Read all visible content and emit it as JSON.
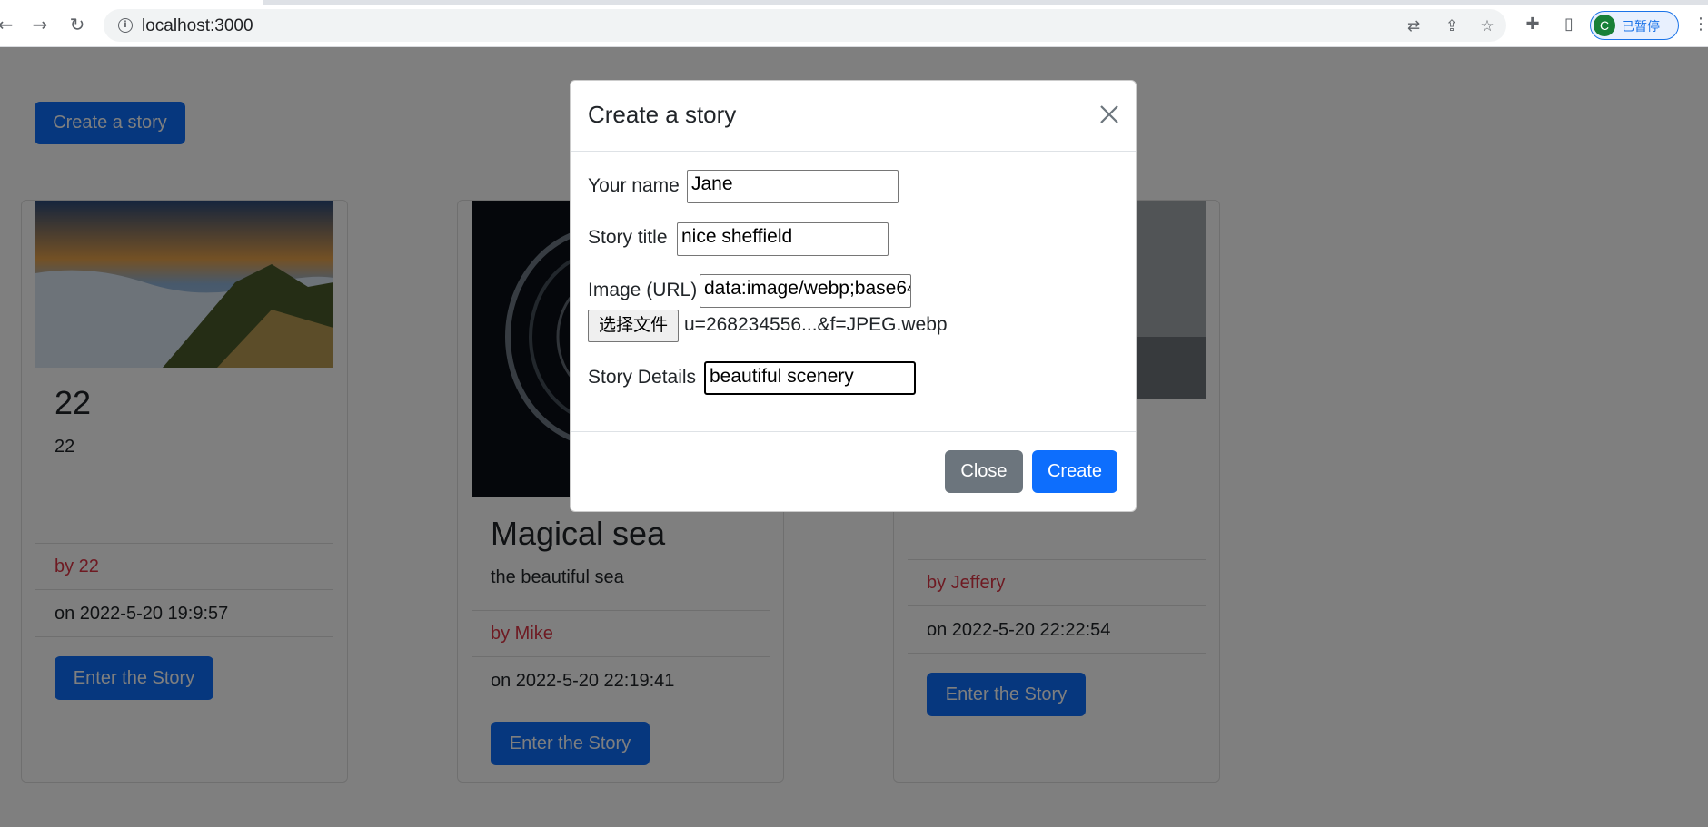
{
  "browser": {
    "url": "localhost:3000",
    "profile_initial": "C",
    "profile_label": "已暂停"
  },
  "page": {
    "create_button": "Create a story",
    "cards": [
      {
        "title": "22",
        "description": "22",
        "author": "by 22",
        "date": "on 2022-5-20 19:9:57",
        "button": "Enter the Story"
      },
      {
        "title": "Magical sea",
        "description": "the beautiful sea",
        "author": "by Mike",
        "date": "on 2022-5-20 22:19:41",
        "button": "Enter the Story"
      },
      {
        "title": "",
        "description": "",
        "author": "by Jeffery",
        "date": "on 2022-5-20 22:22:54",
        "button": "Enter the Story"
      }
    ]
  },
  "modal": {
    "title": "Create a story",
    "name_label": "Your name",
    "name_value": "Jane",
    "title_label": "Story title",
    "title_value": "nice sheffield",
    "image_label": "Image (URL)",
    "image_value": "data:image/webp;base64",
    "file_button": "选择文件",
    "file_name": "u=268234556...&f=JPEG.webp",
    "details_label": "Story Details",
    "details_value": "beautiful scenery",
    "close_button": "Close",
    "create_button": "Create"
  },
  "colors": {
    "primary": "#0d6efd",
    "secondary": "#6c757d",
    "author": "#dc3545"
  }
}
